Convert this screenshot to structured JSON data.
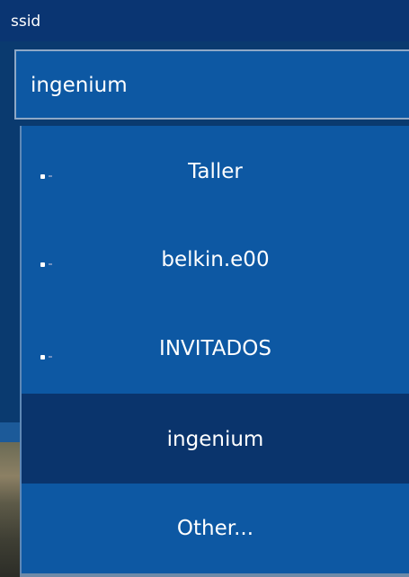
{
  "header": {
    "label": "ssid"
  },
  "ssid_field": {
    "value": "ingenium"
  },
  "dropdown": {
    "options": [
      {
        "label": "Taller",
        "has_marker": true,
        "selected": false
      },
      {
        "label": "belkin.e00",
        "has_marker": true,
        "selected": false
      },
      {
        "label": "INVITADOS",
        "has_marker": true,
        "selected": false
      },
      {
        "label": "ingenium",
        "has_marker": false,
        "selected": true
      },
      {
        "label": "Other...",
        "has_marker": false,
        "selected": false
      }
    ]
  },
  "colors": {
    "header_bg": "#0a3572",
    "list_bg": "#0d58a3",
    "selected_bg": "#0a346c",
    "text": "#ffffff"
  }
}
